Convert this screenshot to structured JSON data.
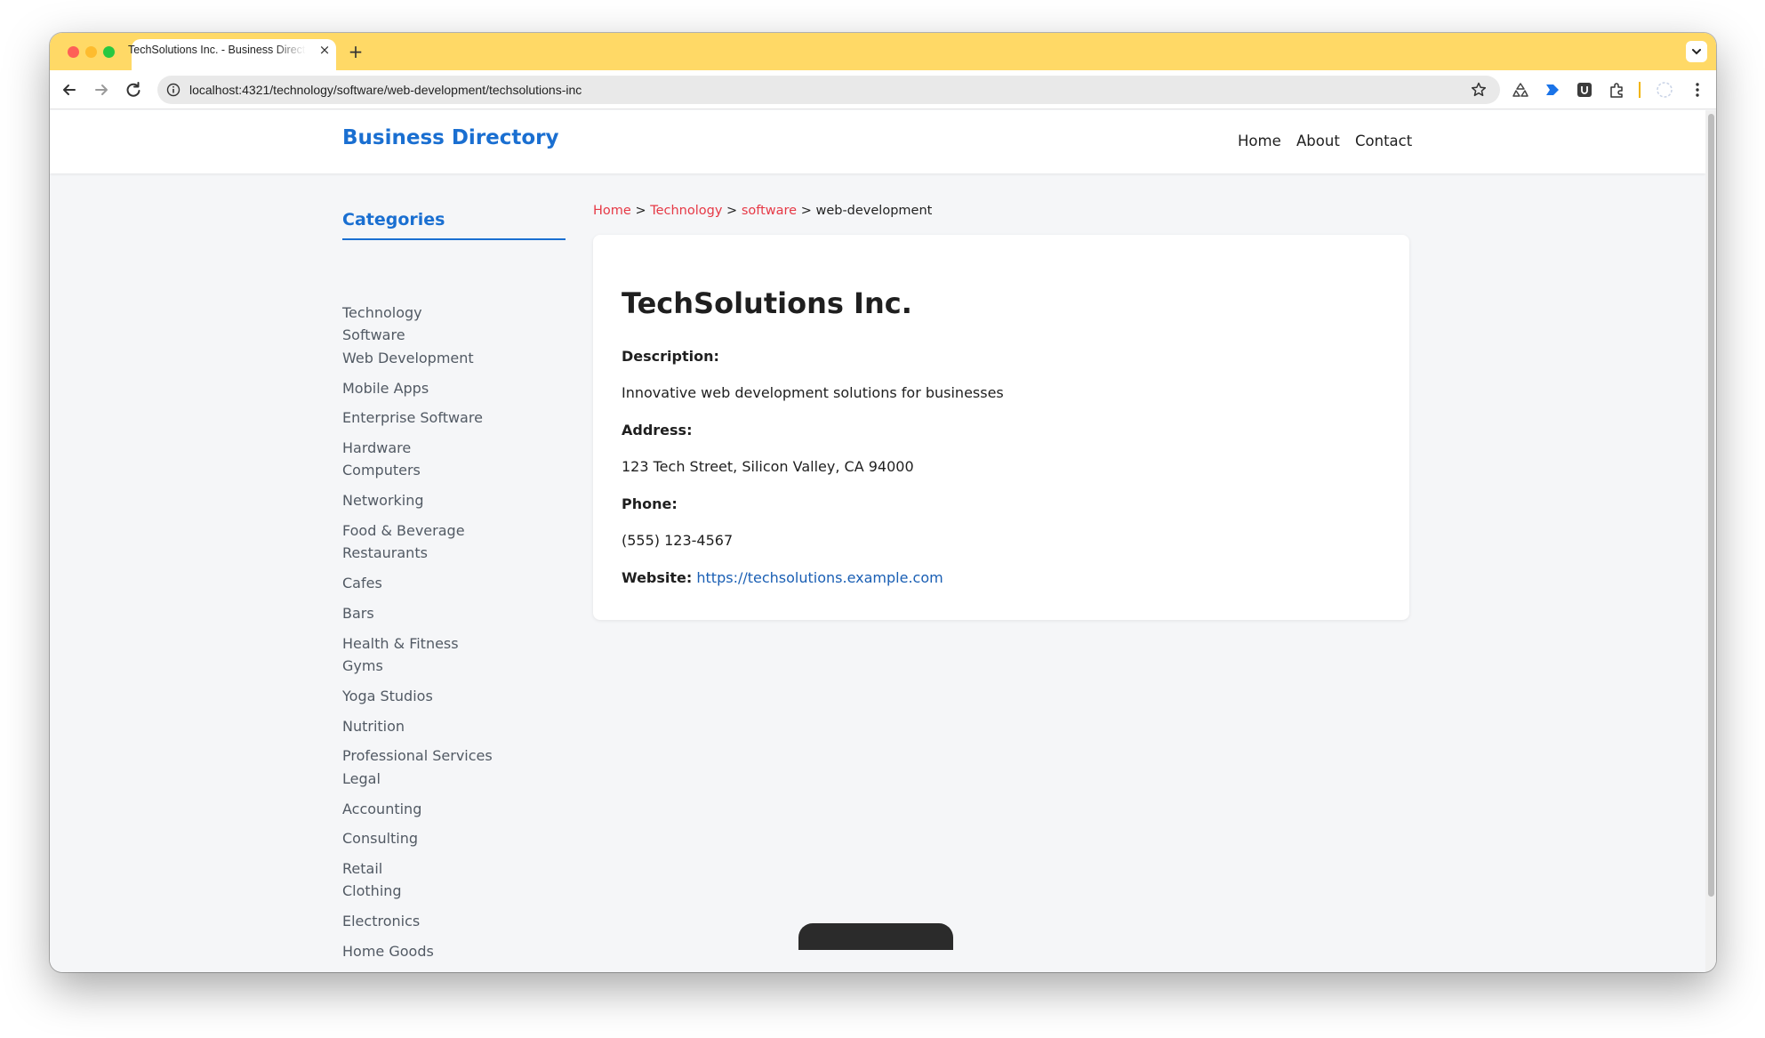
{
  "browser": {
    "tab_title": "TechSolutions Inc. - Business Directory",
    "new_tab_label": "+",
    "close_label": "×",
    "url": "localhost:4321/technology/software/web-development/techsolutions-inc",
    "theme_color": "#ffd966"
  },
  "site": {
    "logo": "Business Directory",
    "nav": {
      "home": "Home",
      "about": "About",
      "contact": "Contact"
    },
    "accent_color": "#1a6fd1"
  },
  "sidebar": {
    "title": "Categories",
    "items": [
      "Technology",
      "Software",
      "Web Development",
      "Mobile Apps",
      "Enterprise Software",
      "Hardware",
      "Computers",
      "Networking",
      "Food & Beverage",
      "Restaurants",
      "Cafes",
      "Bars",
      "Health & Fitness",
      "Gyms",
      "Yoga Studios",
      "Nutrition",
      "Professional Services",
      "Legal",
      "Accounting",
      "Consulting",
      "Retail",
      "Clothing",
      "Electronics",
      "Home Goods"
    ]
  },
  "breadcrumb": {
    "home": "Home",
    "technology": "Technology",
    "software": "software",
    "current": "web-development",
    "separator": ">"
  },
  "business": {
    "name": "TechSolutions Inc.",
    "description_label": "Description:",
    "description": "Innovative web development solutions for businesses",
    "address_label": "Address:",
    "address": "123 Tech Street, Silicon Valley, CA 94000",
    "phone_label": "Phone:",
    "phone": "(555) 123-4567",
    "website_label": "Website:",
    "website": "https://techsolutions.example.com"
  }
}
